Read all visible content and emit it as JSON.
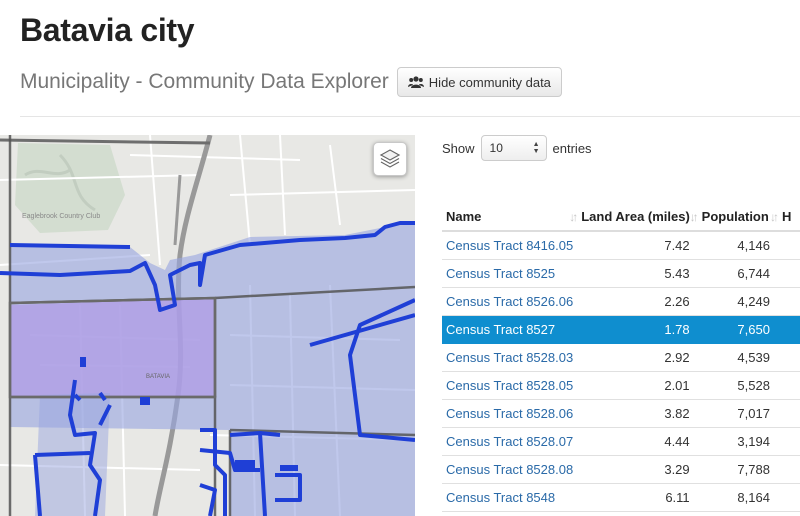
{
  "header": {
    "title": "Batavia city",
    "subtitle": "Municipality - Community Data Explorer",
    "toggle_button": "Hide community data"
  },
  "map": {
    "labels": {
      "golf_club": "Eaglebrook Country Club",
      "city": "BATAVIA"
    }
  },
  "table_controls": {
    "show_label": "Show",
    "entries_value": "10",
    "entries_label": "entries"
  },
  "table": {
    "columns": [
      "Name",
      "Land Area (miles)",
      "Population",
      "H"
    ],
    "rows": [
      {
        "name": "Census Tract 8416.05",
        "land_area": "7.42",
        "population": "4,146"
      },
      {
        "name": "Census Tract 8525",
        "land_area": "5.43",
        "population": "6,744"
      },
      {
        "name": "Census Tract 8526.06",
        "land_area": "2.26",
        "population": "4,249"
      },
      {
        "name": "Census Tract 8527",
        "land_area": "1.78",
        "population": "7,650",
        "selected": true
      },
      {
        "name": "Census Tract 8528.03",
        "land_area": "2.92",
        "population": "4,539"
      },
      {
        "name": "Census Tract 8528.05",
        "land_area": "2.01",
        "population": "5,528"
      },
      {
        "name": "Census Tract 8528.06",
        "land_area": "3.82",
        "population": "7,017"
      },
      {
        "name": "Census Tract 8528.07",
        "land_area": "4.44",
        "population": "3,194"
      },
      {
        "name": "Census Tract 8528.08",
        "land_area": "3.29",
        "population": "7,788"
      },
      {
        "name": "Census Tract 8548",
        "land_area": "6.11",
        "population": "8,164"
      }
    ]
  },
  "colors": {
    "selected_row": "#0f8ecf",
    "link": "#2a6aa8",
    "boundary_blue": "#1f3fd6",
    "tract_fill": "#9aa6e0",
    "selected_tract_fill": "#b09ce6"
  }
}
